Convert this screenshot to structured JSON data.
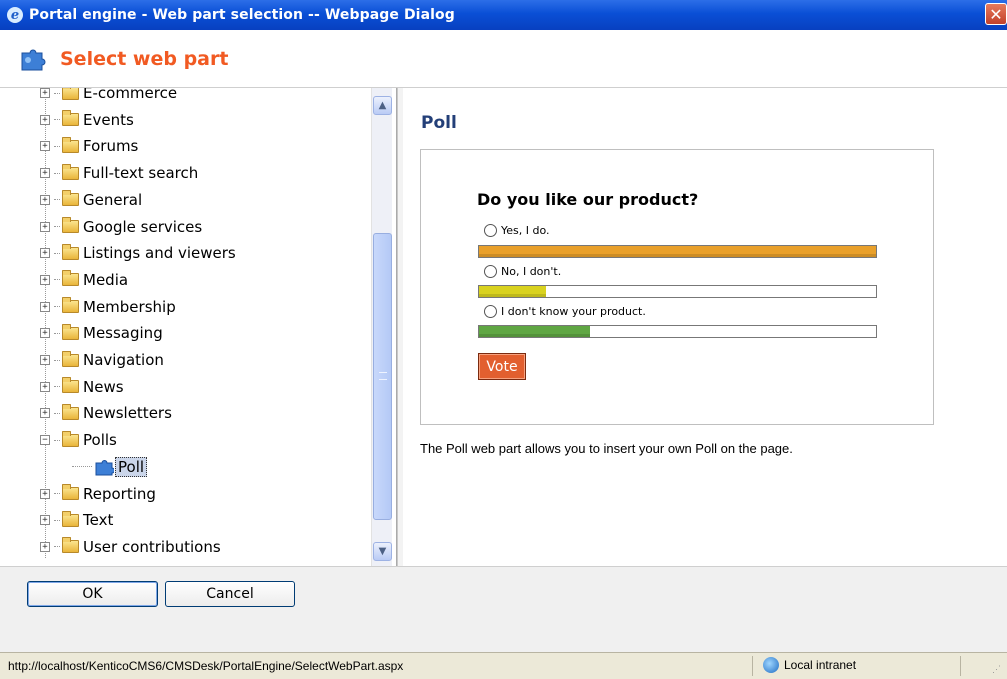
{
  "window": {
    "title": "Portal engine - Web part selection -- Webpage Dialog",
    "close_symbol": "✕"
  },
  "header": {
    "title": "Select web part",
    "icon": "puzzle-piece-icon"
  },
  "tree": {
    "partial_top_item": "E-commerce",
    "categories": [
      "Events",
      "Forums",
      "Full-text search",
      "General",
      "Google services",
      "Listings and viewers",
      "Media",
      "Membership",
      "Messaging",
      "Navigation",
      "News",
      "Newsletters",
      "Polls"
    ],
    "expanded_category": "Polls",
    "selected_item": "Poll",
    "categories_after": [
      "Reporting",
      "Text",
      "User contributions"
    ],
    "plus_symbol": "+",
    "minus_symbol": "−"
  },
  "preview": {
    "title": "Poll",
    "question": "Do you like our product?",
    "options": [
      {
        "label": "Yes, I do.",
        "percent": 100,
        "color": "#e9a02a"
      },
      {
        "label": "No, I don't.",
        "percent": 17,
        "color": "#d9d21f"
      },
      {
        "label": "I don't know your product.",
        "percent": 28,
        "color": "#5fa643"
      }
    ],
    "vote_label": "Vote",
    "description": "The Poll web part allows you to insert your own Poll on the page."
  },
  "buttons": {
    "ok_label": "OK",
    "cancel_label": "Cancel"
  },
  "statusbar": {
    "url": "http://localhost/KenticoCMS6/CMSDesk/PortalEngine/SelectWebPart.aspx",
    "zone": "Local intranet"
  },
  "scrollbar": {
    "up_symbol": "▲",
    "down_symbol": "▼"
  }
}
